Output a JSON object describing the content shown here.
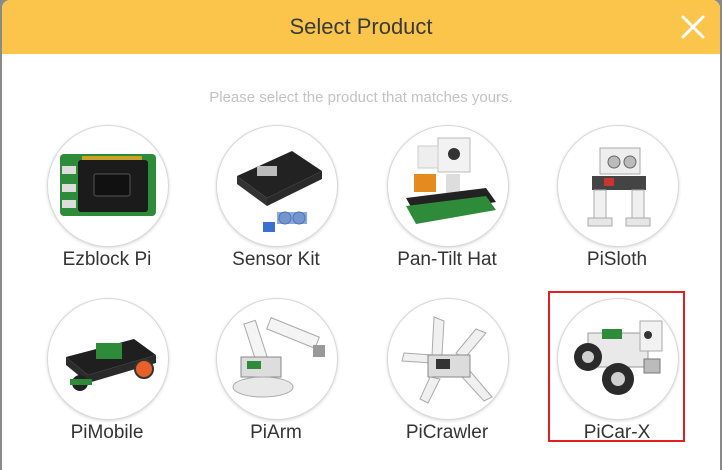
{
  "dialog": {
    "title": "Select Product",
    "subtitle": "Please select the product that matches yours."
  },
  "products": [
    {
      "label": "Ezblock Pi",
      "icon": "ezblock-pi-board-icon"
    },
    {
      "label": "Sensor Kit",
      "icon": "sensor-kit-icon"
    },
    {
      "label": "Pan-Tilt Hat",
      "icon": "pan-tilt-hat-icon"
    },
    {
      "label": "PiSloth",
      "icon": "pisloth-robot-icon"
    },
    {
      "label": "PiMobile",
      "icon": "pimobile-car-icon"
    },
    {
      "label": "PiArm",
      "icon": "piarm-robot-arm-icon"
    },
    {
      "label": "PiCrawler",
      "icon": "picrawler-spider-icon"
    },
    {
      "label": "PiCar-X",
      "icon": "picar-x-car-icon"
    }
  ],
  "selected_product": "PiCar-X",
  "colors": {
    "header": "#fbc44a",
    "selection_border": "#e02020",
    "subtitle": "#c3c3c3"
  }
}
